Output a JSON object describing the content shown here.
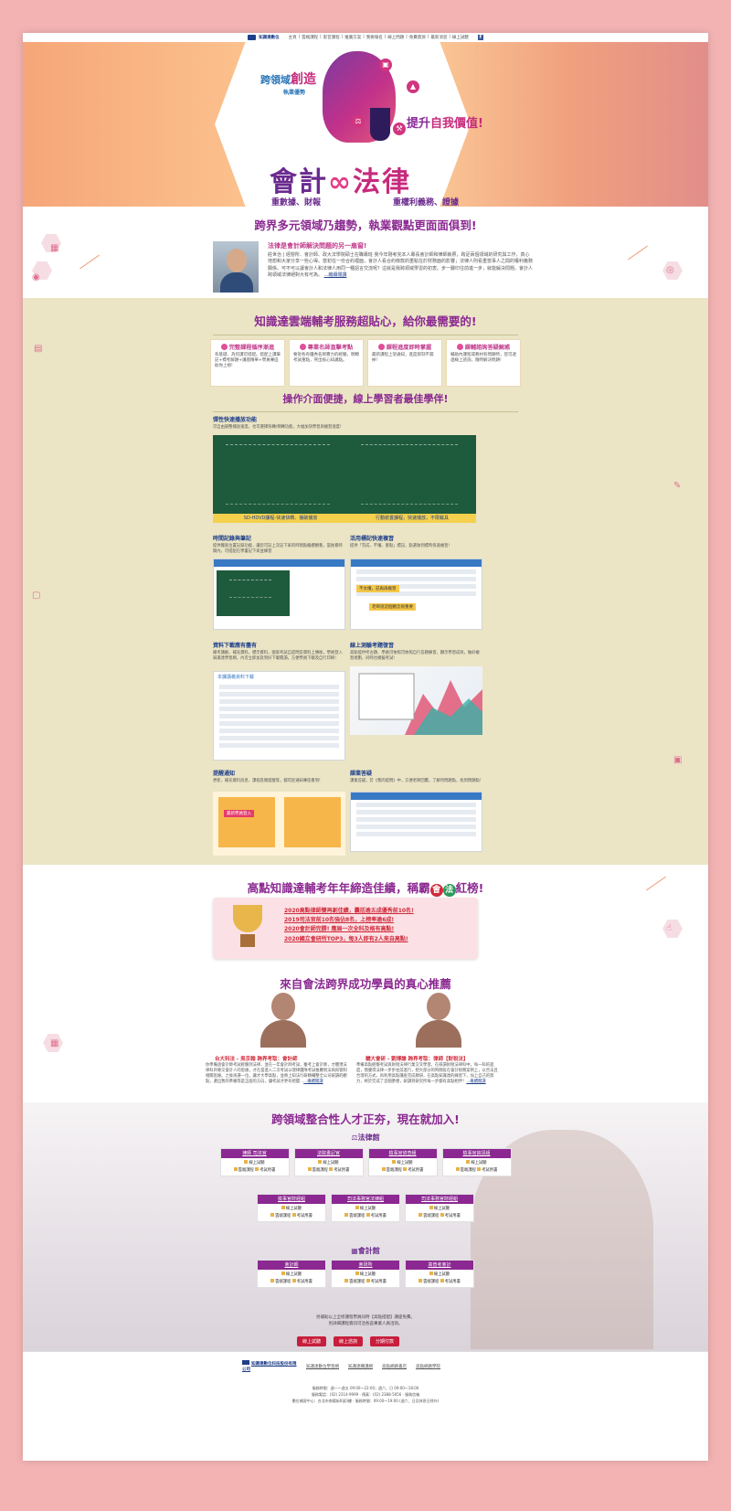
{
  "topbar": {
    "logo": "知識達數位",
    "links": [
      "主頁",
      "雲端課程",
      "影音課程",
      "推廣方案",
      "我要報名",
      "線上問題",
      "免費資源",
      "最新消息",
      "線上試聽"
    ],
    "fb": "f"
  },
  "hero": {
    "t1a": "跨領域",
    "t1b": "創造",
    "t1c": "執業優勢",
    "t2a": "提升",
    "t2b": "自我價值!",
    "main_a": "會計",
    "main_inf": "∞",
    "main_b": "法律",
    "sub1": "重數據、財報",
    "sub2": "重權利義務、證據"
  },
  "intro": {
    "title": "跨界多元領域乃趨勢，執業觀點更面面俱到!",
    "heading": "法律是會計師解決問題的另一扇窗!",
    "text": "莊世治 | 經營所、會計師、政大法學院碩士在職專班 我今年剛考完本人專長會計師和律師執照，跨足兩個領域的研究與工作，真心地想和大家分享一些心得。當初在一份合約裡面，會計人看合約條款的重點在於財務面的影響；法律人則看重當事人之間的權利義務關係。可不可以讓會計人和法律人用同一種語言交流呢？這就是我跨領域學習的初衷。步一腳印往前進一步，就能解決問題。會計人跨領域法律絕對大有可為。",
    "more": "...繼續閱讀"
  },
  "services": {
    "title": "知識達雲端輔考服務超貼心，給你最需要的!",
    "cards": [
      {
        "title": "完整課程循序漸進",
        "text": "有基礎、為何課可搭配。搭配上課筆記+標考解題+講座精華+學員專區助你上榜!"
      },
      {
        "title": "專業名師直擊考點",
        "text": "要從各有優秀名師實力的經驗，明瞭考試重點，突出核心知識點。"
      },
      {
        "title": "課程進度即時掌握",
        "text": "最新課程上架通知，進度即刻不漏掉!"
      },
      {
        "title": "課輔諮詢答疑解惑",
        "text": "輔助內課程或教材有問題時，皆可透過線上諮詢，隨時解決問題!"
      }
    ],
    "ui_title": "操作介面便捷，線上學習者最佳學伴!",
    "features": [
      {
        "title": "彈性快速播放功能",
        "text": "可自由調整播放速度，也可選擇快轉/倒轉功能，大幅加快學習與複習速度!",
        "captions": [
          "SD-HDVD課程-快速快轉、播破播放",
          "行動裝置課程，快速播放，不限載具"
        ]
      },
      {
        "title": "時間記錄與筆記",
        "text": "提供獨家位置記錄功能，讓您可記上次記下來的時間點繼續觀看，當後看時間內，可搭配在學書記下來並練習"
      },
      {
        "title": "活用標記快速複習",
        "text": "提供「完成、不懂、重點」標記，點選收到標時快速複習!",
        "marks": [
          "不太懂，記再再複習",
          "老師說這個觀念很重要"
        ]
      },
      {
        "title": "資料下載應有盡有",
        "text": "補考講解，補充資料，標示資料，國家考試自認問答資料上傳後，學員登入知識達學習網，內可立即加及到好下載閱讀，方便學員下載及自行印刷!",
        "table_title": "本課講義資料下載"
      },
      {
        "title": "線上測驗考題復習",
        "text": "高點提供考古題、學員可依照可依照自行答題練習，顯示學習成效，做好複習規劃，同時也模擬考試!"
      },
      {
        "title": "提醒通知",
        "text": "更新、補充資料訊息、課程區間提醒等，都可從通知專區看到!",
        "badge": "最新學員登入"
      },
      {
        "title": "課業答疑",
        "text": "課業答疑，於《我的提問》中，方便老師回覆，了解所問題點，找到問題點!"
      }
    ]
  },
  "award": {
    "title_a": "高點知識達輔考年年締造佳績，稱霸",
    "c1": "會",
    "c2": "法",
    "title_b": "紅榜!",
    "items": [
      "2020高點律師雙再創佳績，囊括逾五成優秀前10名!",
      "2019司法官前10名強佔8名，上榜率逾6成!",
      "2020會計師完勝! 應屆一次全科及格有高點!",
      "2020國立會研所TOP3，每3人即有2人來自高點!"
    ]
  },
  "testimonials": {
    "title": "來自會法跨界成功學員的真心推薦",
    "items": [
      {
        "name": "台大科法 - 吳京翰 跨界考取：會計師",
        "text": "你準備過會計師考試經驗到法律，並在一年會計師考試，雖考上會計師，才體現法律科目要交會計人的思維，才在當進入二次考試以理律團隊考試推薦到法商與管制相關思維。之後再選一位，讓才大學高點，並將上知法行研精輔整全公司研讀的觀點，選出我的準備等是正面的方向，讓考試才更有把握...",
        "more": "...繼續閱讀"
      },
      {
        "name": "輔大會研 - 劉博謙 跨界考取：律師【財稅法】",
        "text": "準備高點經驗考試與財稅法律行業交叉學習，在研讀財稅法律科中，每一科的進度，我覺得法律一步步往前進行，把大部分的時間投在會計稅務案例上，以合法且合理的方式，再利用高點講座完成教研，在高點知識達的練習下，加上自己的努力，終於完成了這個夢想，研讀到研究所每一步都有高點相伴！",
        "more": "...繼續閱讀"
      }
    ]
  },
  "join": {
    "title": "跨領域整合性人才正夯，現在就加入!",
    "law_head": "⚖法律館",
    "acc_head": "▦會計館",
    "free": "線上試聽",
    "course": "雲端課程",
    "exam": "考試用書",
    "law_row1": [
      "律師 司法官",
      "法院書記官",
      "檢事官偵查組",
      "檢事官資訊組"
    ],
    "law_row2": [
      "檢事官財經組",
      "司法事務官法律組",
      "司法事務官財經組"
    ],
    "acc_row": [
      "會計師",
      "會研所",
      "高普考會計"
    ],
    "note1": "另補助以上全修課程學員同時【高點搭配】講座免費。",
    "note2": "另詳細課程資訊可洽各區專業人員洽詢。",
    "btns": [
      "線上試聽",
      "線上諮詢",
      "分期付款"
    ]
  },
  "footer": {
    "company": "知識達數位科技股份有限公司",
    "links": [
      "知識達數位學習網",
      "知識達購課網",
      "高點網路書店",
      "高點網路學院"
    ],
    "line1": "服務時間：週一～週五 09:00～22:00；週六、日 09:00～18:00",
    "line2": "服務電話：(02) 2314-9999 ‧ 傳真：(02) 2388-5656 ‧ 服務信箱",
    "line3": "數位補習中心：台北市南陽街6號3樓 ‧ 服務時間：09:00～19:00 (週六、日及休息日除外)"
  }
}
